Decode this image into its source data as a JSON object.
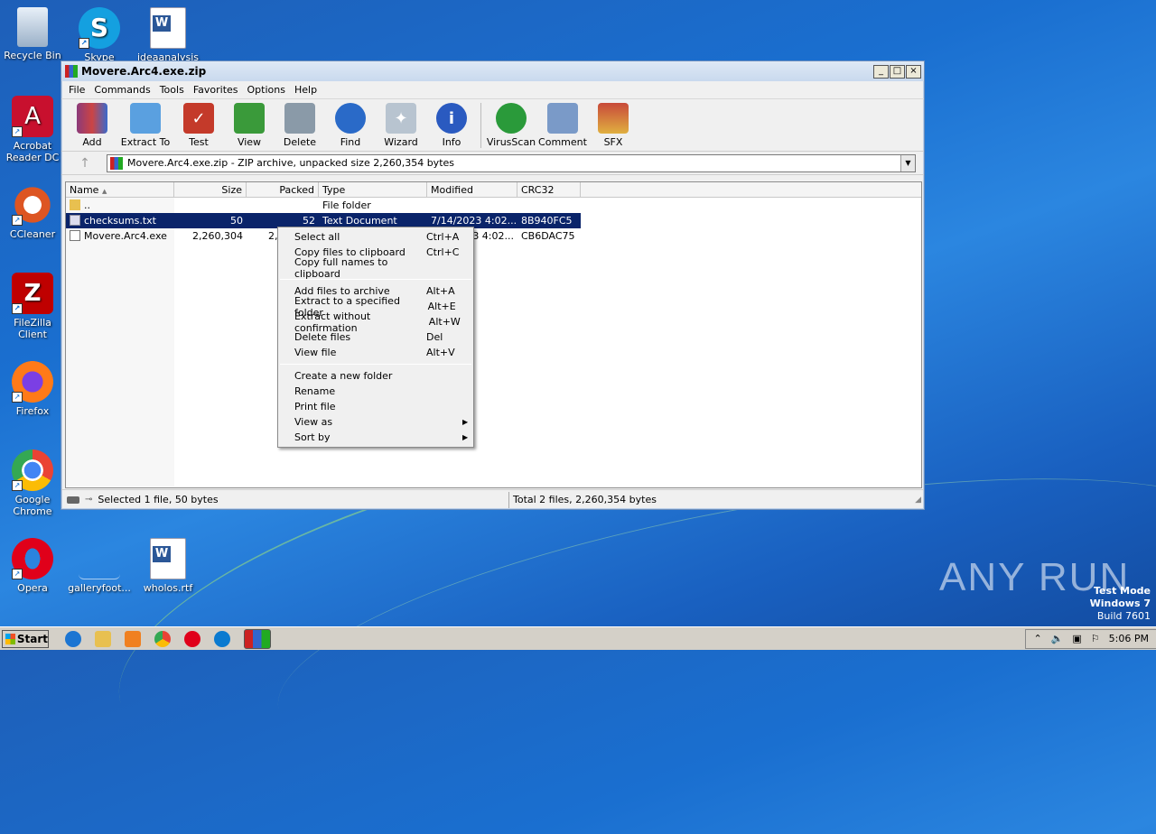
{
  "desktop": {
    "icons": [
      {
        "label": "Recycle Bin"
      },
      {
        "label": "Skype"
      },
      {
        "label": "ideaanalysis"
      },
      {
        "label": "Acrobat Reader DC"
      },
      {
        "label": "CCleaner"
      },
      {
        "label": "FileZilla Client"
      },
      {
        "label": "Firefox"
      },
      {
        "label": "Google Chrome"
      },
      {
        "label": "Opera"
      },
      {
        "label": "galleryfoot..."
      },
      {
        "label": "wholos.rtf"
      }
    ]
  },
  "window": {
    "title": "Movere.Arc4.exe.zip",
    "buttons": {
      "minimize": "_",
      "maximize": "□",
      "close": "×"
    }
  },
  "menu": [
    "File",
    "Commands",
    "Tools",
    "Favorites",
    "Options",
    "Help"
  ],
  "toolbar": [
    {
      "label": "Add",
      "icon": "add-icon",
      "color": "#8b3a7a"
    },
    {
      "label": "Extract To",
      "icon": "extract-folder-icon",
      "color": "#3a8ad4"
    },
    {
      "label": "Test",
      "icon": "test-clipboard-icon",
      "color": "#c43a2a"
    },
    {
      "label": "View",
      "icon": "view-book-icon",
      "color": "#3a9a3a"
    },
    {
      "label": "Delete",
      "icon": "trash-icon",
      "color": "#8a9aa8"
    },
    {
      "label": "Find",
      "icon": "magnifier-icon",
      "color": "#2a6ac8"
    },
    {
      "label": "Wizard",
      "icon": "wand-icon",
      "color": "#9aa8b8"
    },
    {
      "label": "Info",
      "icon": "info-icon",
      "color": "#2a5ac0"
    },
    {
      "label": "VirusScan",
      "icon": "bug-icon",
      "color": "#2a9a3a"
    },
    {
      "label": "Comment",
      "icon": "comment-icon",
      "color": "#7a9ac8"
    },
    {
      "label": "SFX",
      "icon": "sfx-box-icon",
      "color": "#c84a3a"
    }
  ],
  "address": {
    "text": "Movere.Arc4.exe.zip - ZIP archive, unpacked size 2,260,354 bytes"
  },
  "columns": [
    "Name",
    "Size",
    "Packed",
    "Type",
    "Modified",
    "CRC32"
  ],
  "files": [
    {
      "name": "..",
      "size": "",
      "packed": "",
      "type": "File folder",
      "modified": "",
      "crc": ""
    },
    {
      "name": "checksums.txt",
      "size": "50",
      "packed": "52",
      "type": "Text Document",
      "modified": "7/14/2023 4:02...",
      "crc": "8B940FC5"
    },
    {
      "name": "Movere.Arc4.exe",
      "size": "2,260,304",
      "packed": "2,",
      "type": "",
      "modified": "3 4:02...",
      "crc": "CB6DAC75"
    }
  ],
  "status": {
    "left": "Selected 1 file, 50 bytes",
    "right": "Total 2 files, 2,260,354 bytes"
  },
  "context_menu": {
    "group1": [
      {
        "label": "Select all",
        "key": "Ctrl+A"
      },
      {
        "label": "Copy files to clipboard",
        "key": "Ctrl+C"
      },
      {
        "label": "Copy full names to clipboard",
        "key": ""
      }
    ],
    "group2": [
      {
        "label": "Add files to archive",
        "key": "Alt+A"
      },
      {
        "label": "Extract to a specified folder",
        "key": "Alt+E"
      },
      {
        "label": "Extract without confirmation",
        "key": "Alt+W"
      },
      {
        "label": "Delete files",
        "key": "Del"
      },
      {
        "label": "View file",
        "key": "Alt+V"
      }
    ],
    "group3": [
      {
        "label": "Create a new folder",
        "key": ""
      },
      {
        "label": "Rename",
        "key": ""
      },
      {
        "label": "Print file",
        "key": ""
      },
      {
        "label": "View as",
        "key": "▶"
      },
      {
        "label": "Sort by",
        "key": "▶"
      }
    ]
  },
  "watermark": "ANY RUN",
  "testmode": {
    "line1": "Test Mode",
    "line2": "Windows 7",
    "line3": "Build 7601"
  },
  "taskbar": {
    "start": "Start",
    "clock": "5:06 PM"
  }
}
